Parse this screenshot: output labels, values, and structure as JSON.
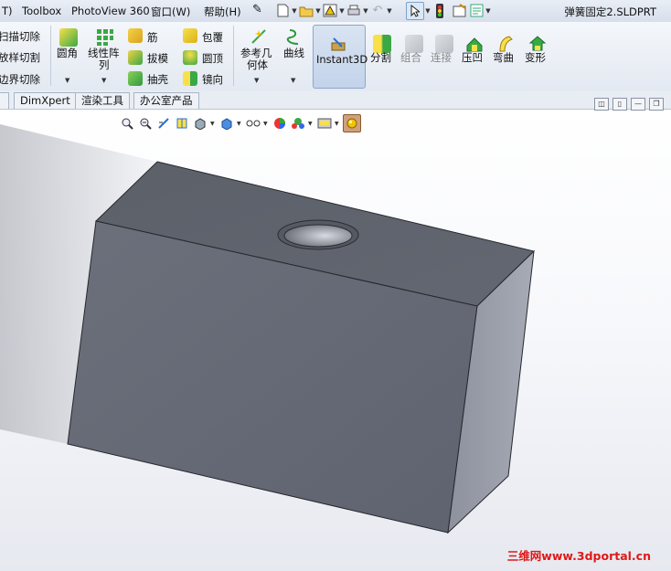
{
  "menubar": {
    "items": [
      "T)",
      "Toolbox",
      "PhotoView 360",
      "窗口(W)",
      "帮助(H)"
    ],
    "document_title": "弹簧固定2.SLDPRT"
  },
  "ribbon": {
    "cut_group": [
      "扫描切除",
      "放样切割",
      "边界切除"
    ],
    "fillet": "圆角",
    "linear_pattern": [
      "线性阵",
      "列"
    ],
    "rib_group": [
      "筋",
      "拔模",
      "抽壳"
    ],
    "wrap_group": [
      "包覆",
      "圆顶",
      "镜向"
    ],
    "ref_geometry": [
      "参考几",
      "何体"
    ],
    "curves": "曲线",
    "instant3d": "Instant3D",
    "split": "分割",
    "combine": "组合",
    "join": "连接",
    "indent": "压凹",
    "flex": "弯曲",
    "deform": "变形"
  },
  "tabs": [
    "",
    "DimXpert",
    "渲染工具",
    "办公室产品"
  ],
  "heads_up_toolbar": [
    "zoom-to-fit-icon",
    "zoom-area-icon",
    "previous-view-icon",
    "section-view-icon",
    "view-orientation-icon",
    "display-style-icon",
    "hide-show-icon",
    "edit-appearance-icon",
    "apply-scene-icon",
    "view-settings-icon",
    "realview-icon"
  ],
  "watermark": "三维网www.3dportal.cn",
  "colors": {
    "model_top": "#5d616b",
    "model_front": "#686c77",
    "model_side": "#9a9eaa",
    "selection_blue": "#dbe8f7",
    "watermark_red": "#e01818"
  }
}
